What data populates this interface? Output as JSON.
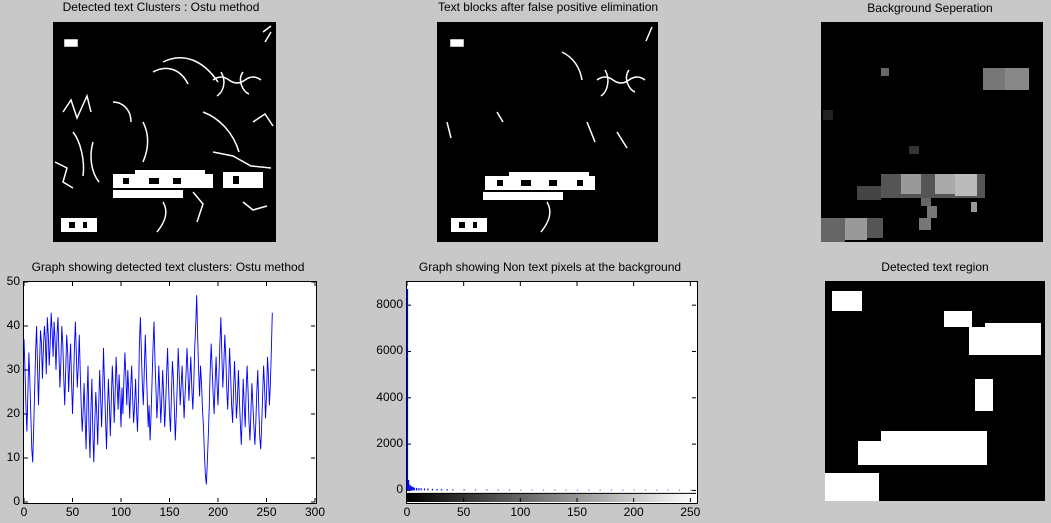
{
  "titles": {
    "panel1": "Detected text Clusters : Ostu method",
    "panel2": "Text blocks after false positive elimination",
    "panel3": "Background Seperation",
    "chart1": "Graph showing detected text clusters: Ostu method",
    "chart2": "Graph showing Non text pixels at the background",
    "panel4": "Detected text region"
  },
  "colors": {
    "figure_bg": "#c8c8c8",
    "line": "#0000ff",
    "image_bg": "#000000",
    "mask": "#ffffff"
  },
  "chart_data": [
    {
      "type": "line",
      "title": "Graph showing detected text clusters: Ostu method",
      "xlabel": "",
      "ylabel": "",
      "xlim": [
        0,
        300
      ],
      "ylim": [
        0,
        50
      ],
      "xticks": [
        0,
        50,
        100,
        150,
        200,
        250,
        300
      ],
      "yticks": [
        0,
        10,
        20,
        30,
        40,
        50
      ],
      "grid": false,
      "series": [
        {
          "color": "#0000ff",
          "x_start": 0,
          "x_step": 1,
          "values": [
            37,
            30,
            22,
            16,
            25,
            34,
            28,
            20,
            12,
            9,
            17,
            26,
            34,
            40,
            30,
            22,
            31,
            39,
            36,
            28,
            35,
            40,
            37,
            29,
            42,
            38,
            31,
            36,
            43,
            39,
            33,
            41,
            37,
            30,
            38,
            42,
            34,
            26,
            32,
            40,
            36,
            28,
            22,
            30,
            38,
            34,
            25,
            31,
            36,
            28,
            20,
            27,
            35,
            41,
            33,
            26,
            31,
            38,
            29,
            22,
            16,
            21,
            27,
            19,
            12,
            24,
            31,
            17,
            10,
            21,
            28,
            15,
            9,
            18,
            25,
            20,
            13,
            22,
            30,
            24,
            17,
            25,
            35,
            27,
            19,
            12,
            20,
            28,
            22,
            15,
            23,
            31,
            26,
            18,
            25,
            33,
            27,
            21,
            29,
            24,
            17,
            26,
            20,
            28,
            34,
            29,
            22,
            30,
            25,
            19,
            26,
            31,
            24,
            18,
            22,
            28,
            21,
            16,
            24,
            36,
            42,
            34,
            27,
            22,
            30,
            38,
            31,
            24,
            17,
            22,
            14,
            20,
            27,
            35,
            41,
            32,
            26,
            19,
            24,
            31,
            25,
            18,
            23,
            30,
            24,
            17,
            22,
            29,
            35,
            27,
            20,
            16,
            24,
            32,
            28,
            21,
            14,
            20,
            27,
            35,
            29,
            22,
            26,
            31,
            25,
            19,
            24,
            29,
            35,
            30,
            23,
            28,
            33,
            26,
            21,
            27,
            35,
            40,
            47,
            38,
            30,
            24,
            31,
            27,
            21,
            17,
            11,
            6,
            4,
            9,
            15,
            22,
            30,
            36,
            30,
            24,
            20,
            27,
            33,
            27,
            22,
            29,
            36,
            42,
            33,
            26,
            31,
            38,
            33,
            26,
            21,
            28,
            35,
            29,
            22,
            18,
            25,
            32,
            26,
            19,
            23,
            30,
            24,
            18,
            13,
            20,
            28,
            22,
            17,
            25,
            31,
            25,
            18,
            14,
            21,
            27,
            22,
            17,
            13,
            18,
            25,
            30,
            22,
            15,
            12,
            17,
            24,
            31,
            26,
            19,
            24,
            33,
            29,
            22,
            27,
            35,
            43
          ]
        }
      ]
    },
    {
      "type": "bar",
      "title": "Graph showing Non text pixels at the background",
      "xlabel": "",
      "ylabel": "",
      "xlim": [
        0,
        255
      ],
      "ylim": [
        -500,
        9000
      ],
      "xticks": [
        0,
        50,
        100,
        150,
        200,
        250
      ],
      "yticks": [
        0,
        2000,
        4000,
        6000,
        8000
      ],
      "grid": false,
      "colorbar": "grayscale 0-255",
      "series": [
        {
          "color": "#0000ff",
          "x": [
            0,
            1,
            2,
            3,
            4,
            5,
            6,
            8,
            10,
            12,
            15,
            18,
            22,
            26,
            30,
            35,
            40,
            50,
            60,
            70,
            80,
            90,
            100,
            110,
            120,
            130,
            140,
            150,
            160,
            170,
            180,
            190,
            200,
            210,
            220,
            230,
            240,
            250
          ],
          "values": [
            8700,
            450,
            250,
            200,
            160,
            140,
            120,
            110,
            100,
            90,
            85,
            80,
            70,
            65,
            60,
            55,
            50,
            45,
            40,
            40,
            35,
            35,
            30,
            30,
            30,
            30,
            30,
            30,
            30,
            30,
            30,
            30,
            30,
            30,
            30,
            30,
            30,
            30
          ]
        }
      ]
    }
  ]
}
